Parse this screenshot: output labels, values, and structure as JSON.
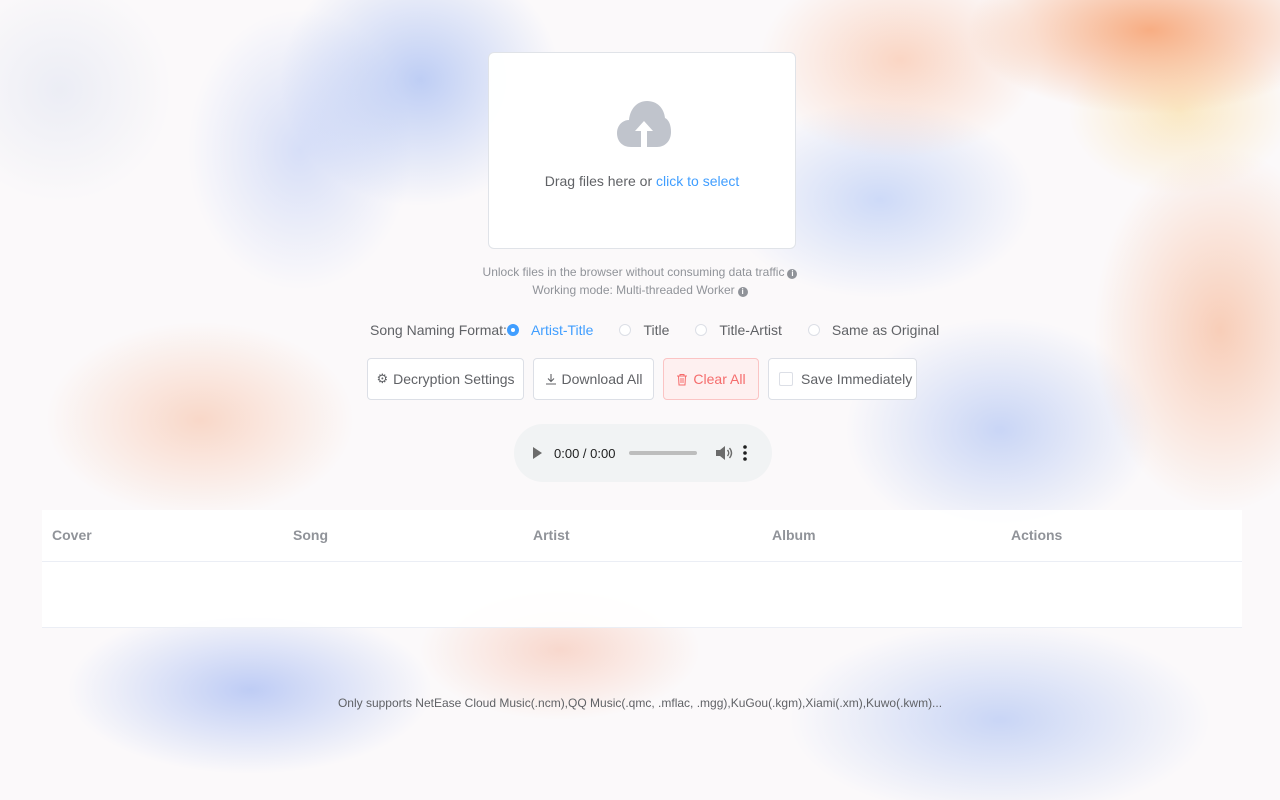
{
  "upload": {
    "text": "Drag files here or ",
    "link": "click to select"
  },
  "tips": {
    "line1": "Unlock files in the browser without consuming data traffic",
    "line2": "Working mode: Multi-threaded Worker",
    "info_glyph": "i"
  },
  "naming": {
    "label": "Song Naming Format:",
    "options": [
      "Artist-Title",
      "Title",
      "Title-Artist",
      "Same as Original"
    ],
    "selected": "Artist-Title"
  },
  "buttons": {
    "decryption_settings": "Decryption Settings",
    "download_all": "Download All",
    "clear_all": "Clear All",
    "save_immediately": "Save Immediately"
  },
  "player": {
    "time": "0:00 / 0:00"
  },
  "table": {
    "columns": [
      "Cover",
      "Song",
      "Artist",
      "Album",
      "Actions"
    ]
  },
  "footer": {
    "text": "Only supports NetEase Cloud Music(.ncm),QQ Music(.qmc, .mflac, .mgg),KuGou(.kgm),Xiami(.xm),Kuwo(.kwm)..."
  },
  "colors": {
    "accent": "#409eff",
    "danger": "#f56c6c",
    "danger_bg": "#fef0f0"
  }
}
